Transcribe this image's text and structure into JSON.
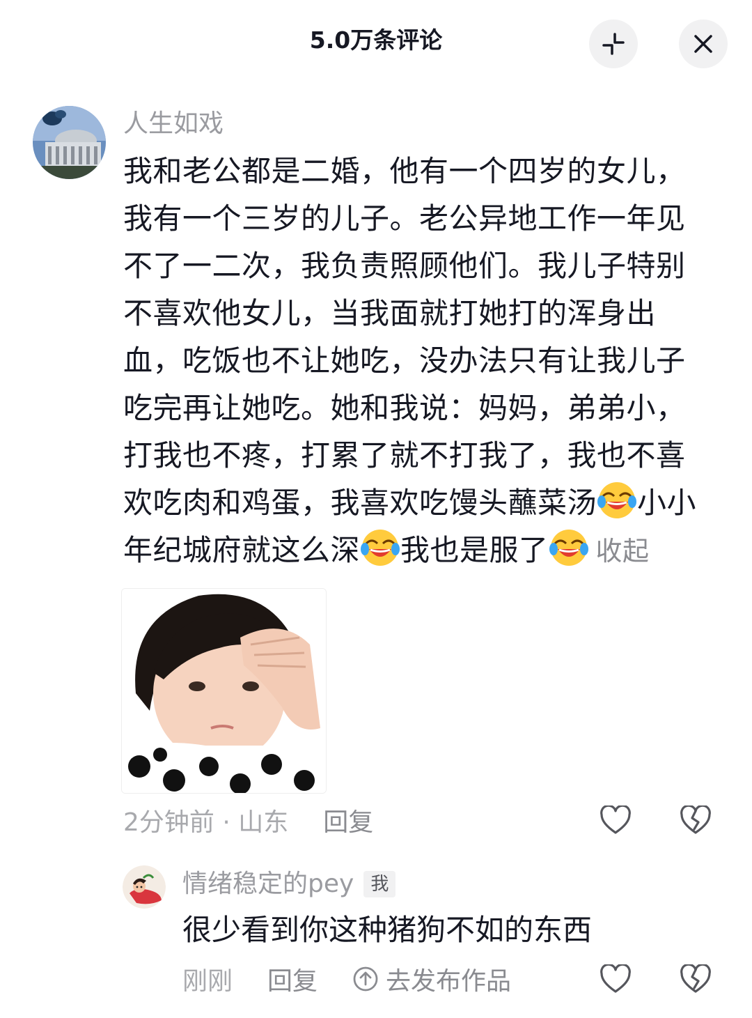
{
  "header": {
    "title": "5.0万条评论"
  },
  "comment": {
    "username": "人生如戏",
    "lines": [
      "我和老公都是二婚，他有一个四岁的女儿，",
      "我有一个三岁的儿子。老公异地工作一年见",
      "不了一二次，我负责照顾他们。我儿子特别",
      "不喜欢他女儿，当我面就打她打的浑身出",
      "血，吃饭也不让她吃，没办法只有让我儿子",
      "吃完再让她吃。她和我说：妈妈，弟弟小，",
      "打我也不疼，打累了就不打我了，我也不喜"
    ],
    "line8_a": "欢吃肉和鸡蛋，我喜欢吃馒头蘸菜汤",
    "line8_b": "小小",
    "line9_a": "年纪城府就这么深",
    "line9_b": "我也是服了",
    "collapse": "收起",
    "emoji_name": "laugh-cry-emoji",
    "time_location": "2分钟前 · 山东",
    "reply_label": "回复"
  },
  "reply": {
    "username": "情绪稳定的pey",
    "badge": "我",
    "text": "很少看到你这种猪狗不如的东西",
    "time": "刚刚",
    "reply_label": "回复",
    "publish_label": "去发布作品"
  },
  "colors": {
    "text_primary": "#161823",
    "text_secondary": "#9a9ba0",
    "button_bg": "#f1f1f2"
  }
}
